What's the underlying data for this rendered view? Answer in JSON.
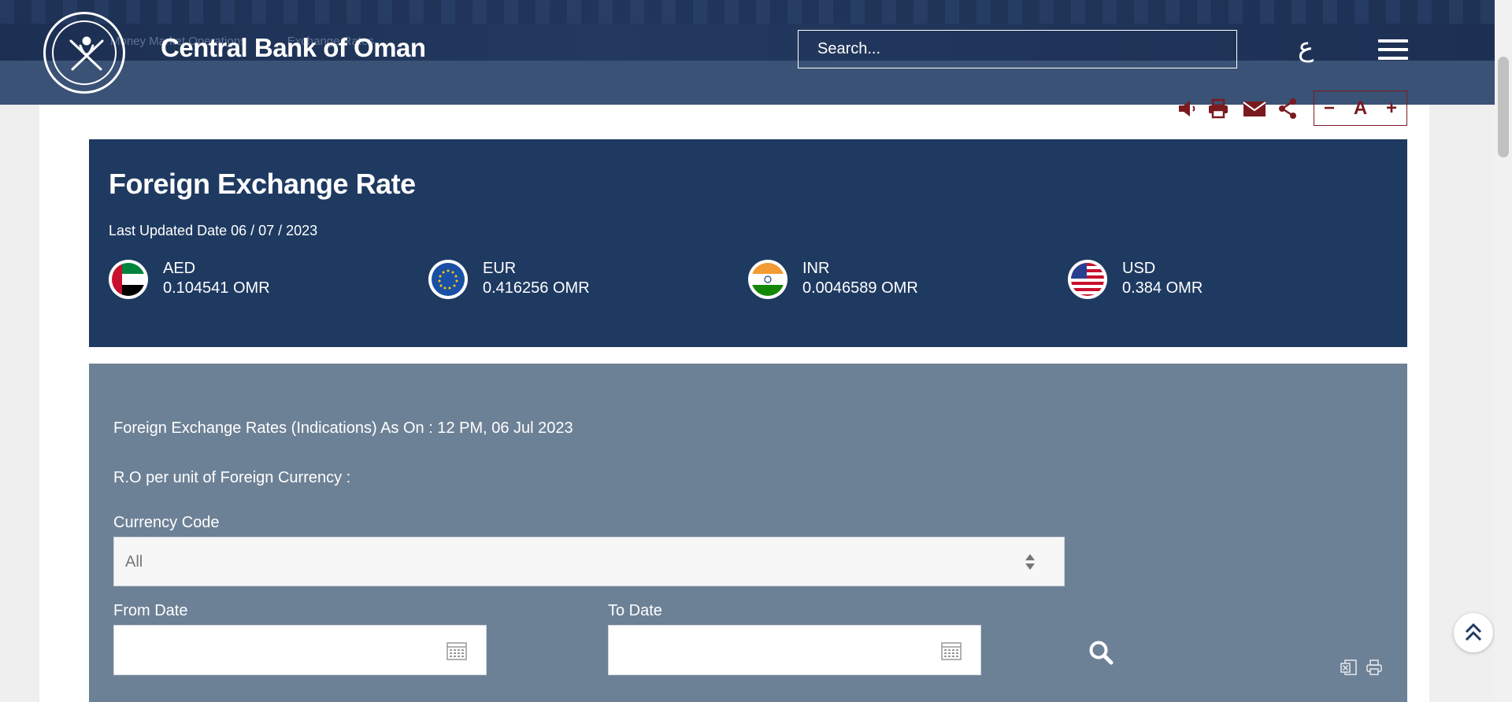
{
  "header": {
    "title": "Central Bank of Oman",
    "breadcrumb": [
      "Money Market Operations",
      "Exchange Rates"
    ],
    "search_placeholder": "Search...",
    "language_toggle": "ع"
  },
  "toolbar": {
    "font_decrease": "−",
    "font_label": "A",
    "font_increase": "+"
  },
  "fx": {
    "title": "Foreign Exchange Rate",
    "last_updated": "Last Updated Date 06 / 07 / 2023",
    "rates": [
      {
        "code": "AED",
        "value": "0.104541 OMR"
      },
      {
        "code": "EUR",
        "value": "0.416256 OMR"
      },
      {
        "code": "INR",
        "value": "0.0046589 OMR"
      },
      {
        "code": "USD",
        "value": "0.384 OMR"
      }
    ]
  },
  "filter": {
    "as_on": "Foreign Exchange Rates (Indications) As On : 12 PM, 06 Jul 2023",
    "unit_note": "R.O per unit of Foreign Currency :",
    "currency_label": "Currency Code",
    "currency_selected": "All",
    "from_label": "From Date",
    "to_label": "To Date"
  },
  "colors": {
    "header_bg": "#3a5275",
    "fx_panel_bg": "#1f3a61",
    "filter_panel_bg": "#6d8196",
    "accent": "#7a1a1f"
  }
}
